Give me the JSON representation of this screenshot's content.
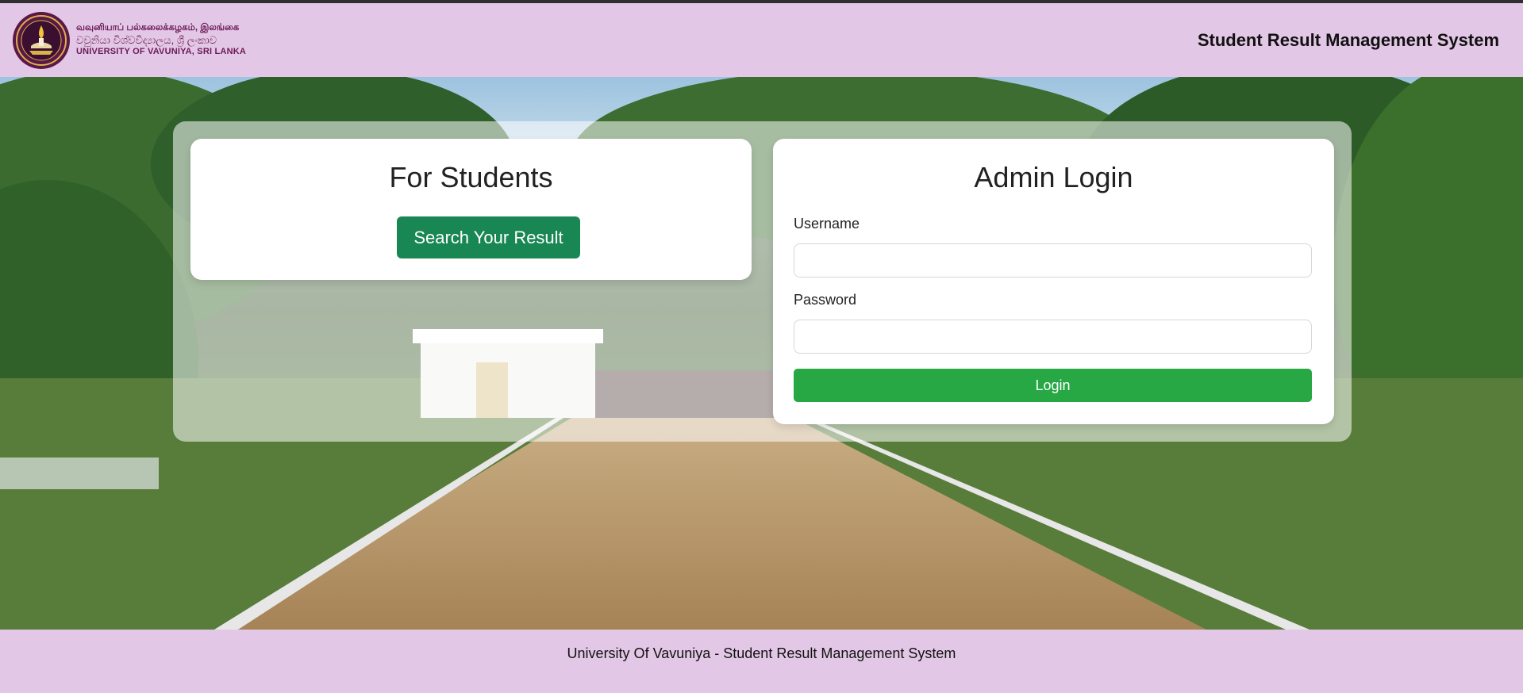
{
  "header": {
    "logo_lines": [
      "வவுனியாப் பல்கலைக்கழகம், இலங்கை",
      "වවුනියා විශ්වවිද්‍යාලය, ශ්‍රී ලංකාව",
      "UNIVERSITY OF VAVUNIYA, SRI LANKA"
    ],
    "title": "Student Result Management System"
  },
  "students_card": {
    "heading": "For Students",
    "search_button": "Search Your Result"
  },
  "admin_card": {
    "heading": "Admin Login",
    "username_label": "Username",
    "username_value": "",
    "password_label": "Password",
    "password_value": "",
    "login_button": "Login"
  },
  "footer": {
    "text": "University Of Vavuniya - Student Result Management System"
  },
  "colors": {
    "header_bg": "#e3c7e6",
    "brand_maroon": "#6b1a57",
    "search_button": "#198754",
    "login_button": "#28a745"
  },
  "icons": {
    "logo": "university-crest-icon"
  }
}
